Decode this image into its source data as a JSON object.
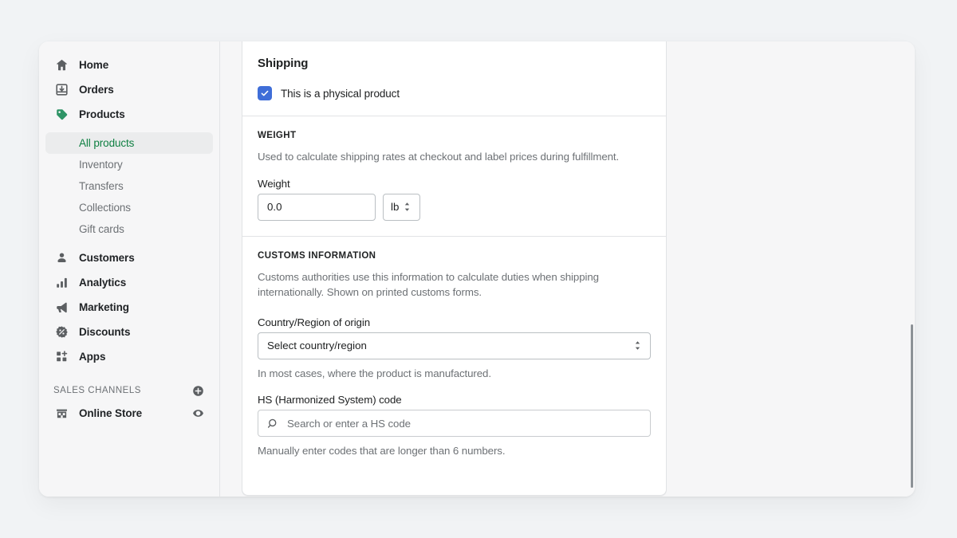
{
  "sidebar": {
    "items": [
      {
        "label": "Home",
        "icon": "home-icon"
      },
      {
        "label": "Orders",
        "icon": "orders-inbox-icon"
      },
      {
        "label": "Products",
        "icon": "product-tag-icon"
      }
    ],
    "sub_items": [
      {
        "label": "All products",
        "active": true
      },
      {
        "label": "Inventory",
        "active": false
      },
      {
        "label": "Transfers",
        "active": false
      },
      {
        "label": "Collections",
        "active": false
      },
      {
        "label": "Gift cards",
        "active": false
      }
    ],
    "items2": [
      {
        "label": "Customers",
        "icon": "customer-person-icon"
      },
      {
        "label": "Analytics",
        "icon": "analytics-bars-icon"
      },
      {
        "label": "Marketing",
        "icon": "marketing-megaphone-icon"
      },
      {
        "label": "Discounts",
        "icon": "discount-percent-icon"
      },
      {
        "label": "Apps",
        "icon": "apps-grid-plus-icon"
      }
    ],
    "sales_channels": {
      "heading": "SALES CHANNELS",
      "add_icon": "plus-circle-icon",
      "channels": [
        {
          "label": "Online Store",
          "icon": "storefront-icon",
          "trailing_icon": "eye-icon"
        }
      ]
    },
    "active_accent": "#108043"
  },
  "shipping": {
    "title": "Shipping",
    "physical_checkbox": {
      "label": "This is a physical product",
      "checked": true,
      "color": "#3f6ed8",
      "check_icon": "checkmark-icon"
    },
    "weight": {
      "heading": "WEIGHT",
      "help": "Used to calculate shipping rates at checkout and label prices during fulfillment.",
      "field_label": "Weight",
      "value": "0.0",
      "unit": "lb",
      "unit_icon": "updown-chevrons-icon"
    },
    "customs": {
      "heading": "CUSTOMS INFORMATION",
      "help": "Customs authorities use this information to calculate duties when shipping internationally. Shown on printed customs forms.",
      "country_label": "Country/Region of origin",
      "country_value": "Select country/region",
      "country_icon": "updown-chevrons-icon",
      "country_help": "In most cases, where the product is manufactured.",
      "hs_label": "HS (Harmonized System) code",
      "hs_placeholder": "Search or enter a HS code",
      "hs_icon": "search-icon",
      "hs_help": "Manually enter codes that are longer than 6 numbers."
    }
  }
}
